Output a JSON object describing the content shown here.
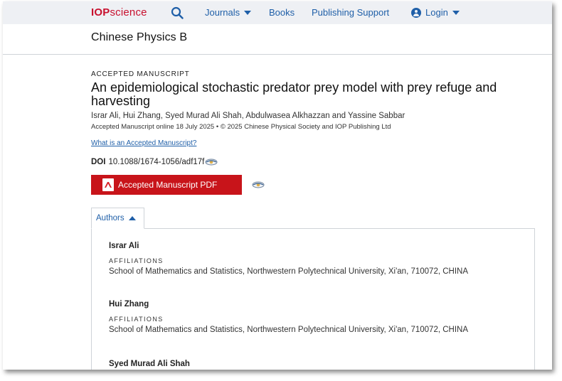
{
  "header": {
    "logo_iop": "IOP",
    "logo_science": "science",
    "nav": {
      "journals": "Journals",
      "books": "Books",
      "publishing_support": "Publishing Support",
      "login": "Login"
    },
    "accent_color": "#1f5fa8",
    "brand_color": "#c8102e"
  },
  "journal": {
    "title": "Chinese Physics B"
  },
  "article": {
    "eyebrow": "ACCEPTED MANUSCRIPT",
    "title": "An epidemiological stochastic predator prey model with prey refuge and harvesting",
    "authors": "Israr Ali, Hui Zhang, Syed Murad Ali Shah, Abdulwasea Alkhazzan and Yassine Sabbar",
    "publication": "Accepted Manuscript online 18 July 2025 • © 2025 Chinese Physical Society and IOP Publishing Ltd",
    "what_link": "What is an Accepted Manuscript?",
    "doi_label": "DOI",
    "doi": "10.1088/1674-1056/adf17f",
    "pdf_button": "Accepted Manuscript PDF"
  },
  "authors_panel": {
    "tab_label": "Authors",
    "entries": [
      {
        "name": "Israr Ali",
        "aff_label": "AFFILIATIONS",
        "affiliation": "School of Mathematics and Statistics, Northwestern Polytechnical University, Xi'an, 710072, CHINA"
      },
      {
        "name": "Hui Zhang",
        "aff_label": "AFFILIATIONS",
        "affiliation": "School of Mathematics and Statistics, Northwestern Polytechnical University, Xi'an, 710072, CHINA"
      },
      {
        "name": "Syed Murad Ali Shah"
      }
    ]
  }
}
